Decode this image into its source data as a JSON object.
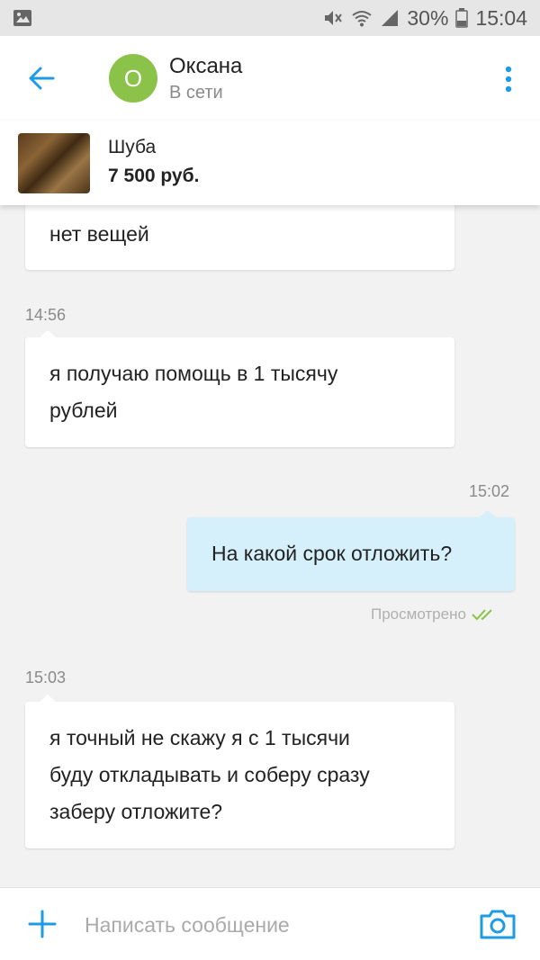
{
  "status_bar": {
    "battery": "30%",
    "time": "15:04",
    "icons": [
      "gallery-icon",
      "mute-icon",
      "wifi-icon",
      "signal-icon",
      "battery-icon"
    ]
  },
  "header": {
    "back_icon": "back-arrow-icon",
    "avatar_letter": "О",
    "avatar_color": "#8bc34a",
    "contact_name": "Оксана",
    "contact_status": "В сети",
    "menu_icon": "more-vertical-icon",
    "accent_color": "#1e9be6"
  },
  "product": {
    "title": "Шуба",
    "price": "7 500 руб."
  },
  "messages": [
    {
      "direction": "in",
      "time": "",
      "lines": [
        "нет вещей"
      ]
    },
    {
      "direction": "in",
      "time": "14:56",
      "lines": [
        "я получаю помощь в 1 тысячу",
        "рублей"
      ]
    },
    {
      "direction": "out",
      "time": "15:02",
      "lines": [
        "На какой срок отложить?"
      ],
      "status": "Просмотрено"
    },
    {
      "direction": "in",
      "time": "15:03",
      "lines": [
        "я точный не скажу я с 1 тысячи",
        "буду откладывать и соберу сразу",
        "заберу отложите?"
      ]
    }
  ],
  "composer": {
    "placeholder": "Написать сообщение",
    "value": "",
    "add_icon": "plus-icon",
    "camera_icon": "camera-icon"
  }
}
